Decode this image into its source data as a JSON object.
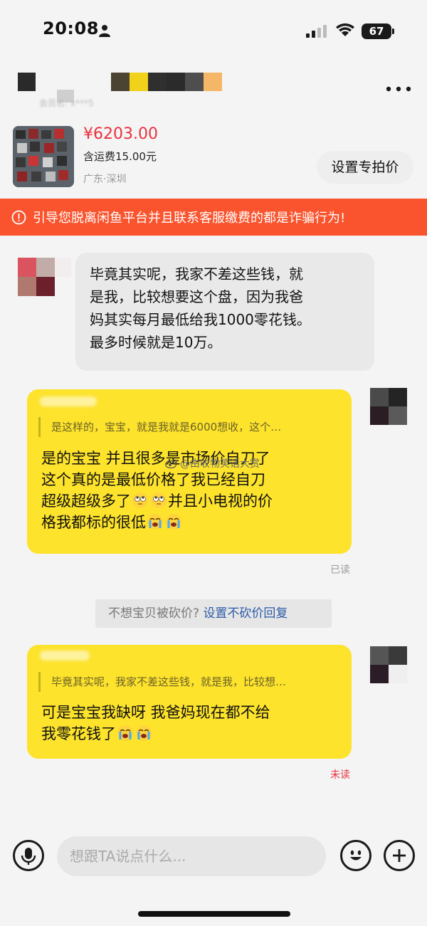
{
  "status_bar": {
    "time": "20:08",
    "battery": "67"
  },
  "header": {
    "subname": "会员名: x***5"
  },
  "product": {
    "price": "¥6203.00",
    "shipping": "含运费15.00元",
    "location": "广东·深圳",
    "special_price_button": "设置专拍价"
  },
  "warning": {
    "text": "引导您脱离闲鱼平台并且联系客服缴费的都是诈骗行为!"
  },
  "messages": {
    "incoming": {
      "lines": [
        "毕竟其实呢，我家不差这些钱，就",
        "是我，比较想要这个盘，因为我爸",
        "妈其实每月最低给我1000零花钱。",
        "最多时候就是10万。"
      ]
    },
    "outgoing_1": {
      "quote": "是这样的，宝宝，就是我就是6000想收，这个…",
      "lines": [
        "是的宝宝 并且很多是市场价自刀了",
        "这个真的是最低价格了我已经自刀",
        "超级超级多了",
        "并且小电视的价",
        "格我都标的很低"
      ],
      "status": "已读"
    },
    "tip": {
      "grey": "不想宝贝被砍价? ",
      "link": "设置不砍价回复"
    },
    "outgoing_2": {
      "quote": "毕竟其实呢，我家不差这些钱，就是我，比较想…",
      "lines": [
        "可是宝宝我缺呀 我爸妈现在都不给",
        "我零花钱了"
      ],
      "status": "未读"
    }
  },
  "watermark": "@由收物笑话大赏",
  "input_bar": {
    "placeholder": "想跟TA说点什么..."
  },
  "colors": {
    "warning_bg": "#f9542e",
    "price": "#e8323e",
    "bubble_out": "#fde32c",
    "read": "#999999",
    "unread": "#e8323e",
    "link": "#2c5aa8"
  },
  "icons": [
    "person-icon",
    "signal-icon",
    "wifi-icon",
    "more-icon",
    "warning-icon",
    "weibo-icon",
    "rolling-eyes-emoji",
    "crying-emoji",
    "microphone-icon",
    "smiley-icon",
    "plus-icon"
  ]
}
